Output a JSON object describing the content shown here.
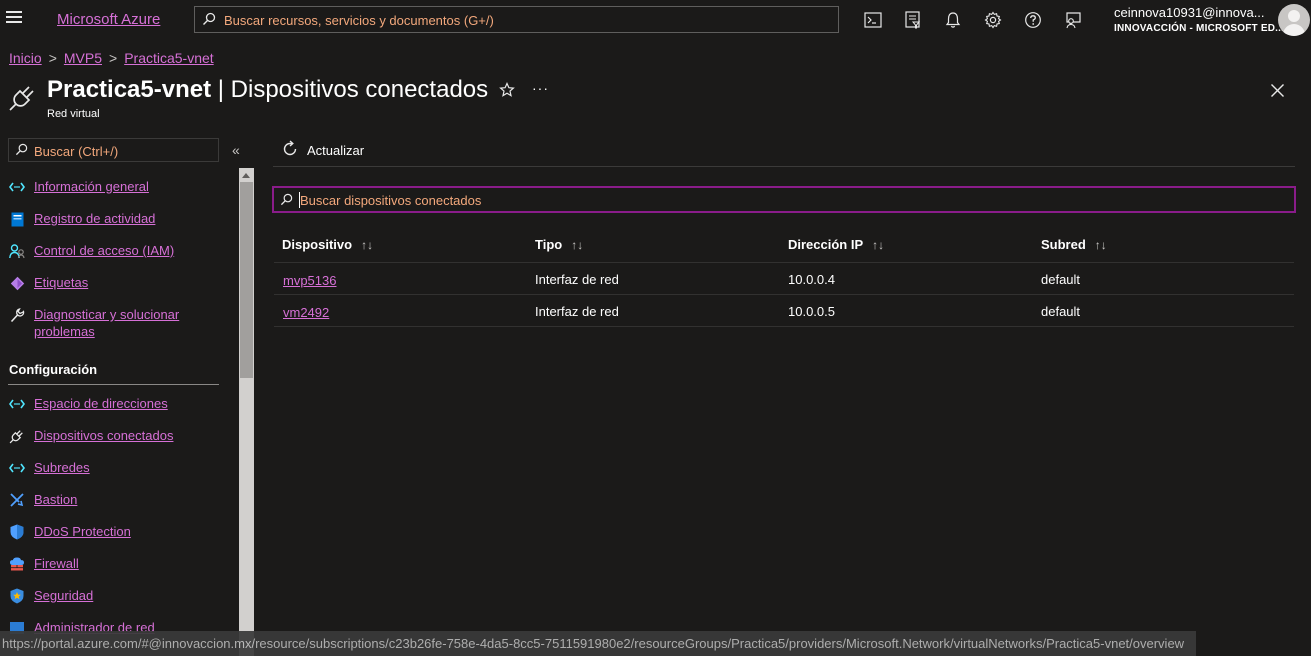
{
  "topbar": {
    "brand": "Microsoft Azure",
    "search_placeholder": "Buscar recursos, servicios y documentos (G+/)",
    "icons": [
      "cloud-shell-icon",
      "directory-filter-icon",
      "notifications-icon",
      "settings-icon",
      "help-icon",
      "feedback-icon"
    ],
    "user_email": "ceinnova10931@innova...",
    "user_org": "INNOVACCIÓN - MICROSOFT ED..."
  },
  "breadcrumb": [
    "Inicio",
    "MVP5",
    "Practica5-vnet"
  ],
  "header": {
    "resource_name": "Practica5-vnet",
    "separator": "|",
    "page_name": "Dispositivos conectados",
    "subtitle": "Red virtual",
    "more": "···"
  },
  "sidebar": {
    "search_placeholder": "Buscar (Ctrl+/)",
    "collapse": "«",
    "items": [
      {
        "label": "Información general",
        "icon": "overview-icon",
        "color": "#50e6ff"
      },
      {
        "label": "Registro de actividad",
        "icon": "activity-log-icon",
        "color": "#0078d4"
      },
      {
        "label": "Control de acceso (IAM)",
        "icon": "iam-icon",
        "color": "#50e6ff"
      },
      {
        "label": "Etiquetas",
        "icon": "tag-icon",
        "color": "#b77de8"
      },
      {
        "label": "Diagnosticar y solucionar problemas",
        "icon": "wrench-icon",
        "color": "#c8c6c4"
      }
    ],
    "section_title": "Configuración",
    "config_items": [
      {
        "label": "Espacio de direcciones",
        "icon": "address-space-icon",
        "color": "#50e6ff"
      },
      {
        "label": "Dispositivos conectados",
        "icon": "plug-icon",
        "color": "#c8c6c4"
      },
      {
        "label": "Subredes",
        "icon": "subnets-icon",
        "color": "#50e6ff"
      },
      {
        "label": "Bastion",
        "icon": "bastion-icon",
        "color": "#50a0ff"
      },
      {
        "label": "DDoS Protection",
        "icon": "ddos-shield-icon",
        "color": "#50a0ff"
      },
      {
        "label": "Firewall",
        "icon": "firewall-icon",
        "color": "#50a0ff"
      },
      {
        "label": "Seguridad",
        "icon": "security-shield-icon",
        "color": "#ffb900"
      },
      {
        "label": "Administrador de red",
        "icon": "network-manager-icon",
        "color": "#50a0ff"
      }
    ]
  },
  "toolbar": {
    "refresh_label": "Actualizar"
  },
  "devices": {
    "search_placeholder": "Buscar dispositivos conectados",
    "columns": [
      "Dispositivo",
      "Tipo",
      "Dirección IP",
      "Subred"
    ],
    "sort_glyph": "↑↓",
    "rows": [
      {
        "device": "mvp5136",
        "type": "Interfaz de red",
        "ip": "10.0.0.4",
        "subnet": "default"
      },
      {
        "device": "vm2492",
        "type": "Interfaz de red",
        "ip": "10.0.0.5",
        "subnet": "default"
      }
    ]
  },
  "status_url": "https://portal.azure.com/#@innovaccion.mx/resource/subscriptions/c23b26fe-758e-4da5-8cc5-7511591980e2/resourceGroups/Practica5/providers/Microsoft.Network/virtualNetworks/Practica5-vnet/overview"
}
